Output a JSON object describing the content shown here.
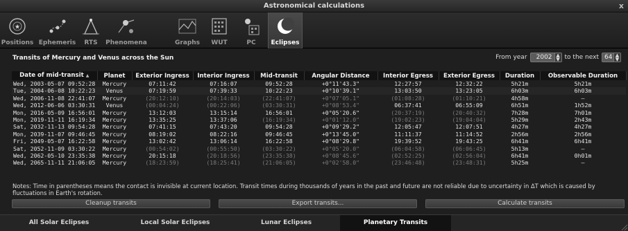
{
  "window": {
    "title": "Astronomical calculations",
    "close_label": "x"
  },
  "toolbar": {
    "tabs": [
      {
        "label": "Positions",
        "icon": "positions-icon"
      },
      {
        "label": "Ephemeris",
        "icon": "ephemeris-icon"
      },
      {
        "label": "RTS",
        "icon": "rts-icon"
      },
      {
        "label": "Phenomena",
        "icon": "phenomena-icon"
      },
      {
        "label": "Graphs",
        "icon": "graphs-icon"
      },
      {
        "label": "WUT",
        "icon": "wut-icon"
      },
      {
        "label": "PC",
        "icon": "pc-icon"
      },
      {
        "label": "Eclipses",
        "icon": "eclipses-icon",
        "active": true
      }
    ]
  },
  "transits": {
    "title": "Transits of Mercury and Venus across the Sun",
    "from_year_label": "From year",
    "from_year_value": "2002",
    "next_label": "to the next",
    "next_value": "64",
    "columns": [
      "Date of mid-transit",
      "Planet",
      "Exterior Ingress",
      "Interior Ingress",
      "Mid-transit",
      "Angular Distance",
      "Interior Egress",
      "Exterior Egress",
      "Duration",
      "Observable Duration"
    ],
    "rows": [
      {
        "date": "Wed, 2003-05-07 09:52:28",
        "planet": "Mercury",
        "ext_in": "07:11:42",
        "int_in": "07:16:07",
        "mid": "09:52:28",
        "ang": "+0°11'43.3\"",
        "int_eg": "12:27:57",
        "ext_eg": "12:32:22",
        "dur": "5h21m",
        "obs": "5h21m",
        "inv": []
      },
      {
        "date": "Tue, 2004-06-08 10:22:23",
        "planet": "Venus",
        "ext_in": "07:19:59",
        "int_in": "07:39:33",
        "mid": "10:22:23",
        "ang": "+0°10'39.1\"",
        "int_eg": "13:03:50",
        "ext_eg": "13:23:05",
        "dur": "6h03m",
        "obs": "6h03m",
        "inv": []
      },
      {
        "date": "Wed, 2006-11-08 22:41:07",
        "planet": "Mercury",
        "ext_in": "(20:12:10)",
        "int_in": "(20:14:03)",
        "mid": "(22:41:07)",
        "ang": "+0°07'05.1\"",
        "int_eg": "(01:08:28)",
        "ext_eg": "(01:10:21)",
        "dur": "4h58m",
        "obs": "—",
        "inv": [
          "ext_in",
          "int_in",
          "mid",
          "ang",
          "int_eg",
          "ext_eg"
        ]
      },
      {
        "date": "Wed, 2012-06-06 03:30:31",
        "planet": "Venus",
        "ext_in": "(00:04:24)",
        "int_in": "(00:22:06)",
        "mid": "(03:30:31)",
        "ang": "+0°08'53.4\"",
        "int_eg": "06:37:41",
        "ext_eg": "06:55:09",
        "dur": "6h51m",
        "obs": "1h52m",
        "inv": [
          "ext_in",
          "int_in",
          "mid",
          "ang"
        ]
      },
      {
        "date": "Mon, 2016-05-09 16:56:01",
        "planet": "Mercury",
        "ext_in": "13:12:03",
        "int_in": "13:15:14",
        "mid": "16:56:01",
        "ang": "+0°05'20.6\"",
        "int_eg": "(20:37:19)",
        "ext_eg": "(20:40:32)",
        "dur": "7h28m",
        "obs": "7h01m",
        "inv": [
          "int_eg",
          "ext_eg"
        ]
      },
      {
        "date": "Mon, 2019-11-11 16:19:34",
        "planet": "Mercury",
        "ext_in": "13:35:25",
        "int_in": "13:37:06",
        "mid": "(16:19:34)",
        "ang": "+0°01'12.0\"",
        "int_eg": "(19:02:23)",
        "ext_eg": "(19:04:04)",
        "dur": "5h29m",
        "obs": "2h43m",
        "inv": [
          "mid",
          "ang",
          "int_eg",
          "ext_eg"
        ]
      },
      {
        "date": "Sat, 2032-11-13 09:54:28",
        "planet": "Mercury",
        "ext_in": "07:41:15",
        "int_in": "07:43:20",
        "mid": "09:54:28",
        "ang": "+0°09'29.2\"",
        "int_eg": "12:05:47",
        "ext_eg": "12:07:51",
        "dur": "4h27m",
        "obs": "4h27m",
        "inv": []
      },
      {
        "date": "Mon, 2039-11-07 09:46:45",
        "planet": "Mercury",
        "ext_in": "08:19:02",
        "int_in": "08:22:16",
        "mid": "09:46:45",
        "ang": "+0°13'45.0\"",
        "int_eg": "11:11:37",
        "ext_eg": "11:14:52",
        "dur": "2h56m",
        "obs": "2h56m",
        "inv": []
      },
      {
        "date": "Fri, 2049-05-07 16:22:58",
        "planet": "Mercury",
        "ext_in": "13:02:42",
        "int_in": "13:06:14",
        "mid": "16:22:58",
        "ang": "+0°08'29.8\"",
        "int_eg": "19:39:52",
        "ext_eg": "19:43:25",
        "dur": "6h41m",
        "obs": "6h41m",
        "inv": []
      },
      {
        "date": "Sat, 2052-11-09 03:30:22",
        "planet": "Mercury",
        "ext_in": "(00:54:02)",
        "int_in": "(00:55:50)",
        "mid": "(03:30:22)",
        "ang": "+0°05'20.0\"",
        "int_eg": "(06:04:58)",
        "ext_eg": "(06:06:45)",
        "dur": "5h13m",
        "obs": "—",
        "inv": [
          "ext_in",
          "int_in",
          "mid",
          "ang",
          "int_eg",
          "ext_eg"
        ]
      },
      {
        "date": "Wed, 2062-05-10 23:35:38",
        "planet": "Mercury",
        "ext_in": "20:15:18",
        "int_in": "(20:18:56)",
        "mid": "(23:35:38)",
        "ang": "+0°08'45.6\"",
        "int_eg": "(02:52:25)",
        "ext_eg": "(02:56:04)",
        "dur": "6h41m",
        "obs": "0h01m",
        "inv": [
          "int_in",
          "mid",
          "ang",
          "int_eg",
          "ext_eg"
        ]
      },
      {
        "date": "Wed, 2065-11-11 21:06:05",
        "planet": "Mercury",
        "ext_in": "(18:23:59)",
        "int_in": "(18:25:41)",
        "mid": "(21:06:05)",
        "ang": "+0°02'58.0\"",
        "int_eg": "(23:46:48)",
        "ext_eg": "(23:48:31)",
        "dur": "5h25m",
        "obs": "—",
        "inv": [
          "ext_in",
          "int_in",
          "mid",
          "ang",
          "int_eg",
          "ext_eg"
        ]
      }
    ],
    "notes": "Notes: Time in parentheses means the contact is invisible at current location. Transit times during thousands of years in the past and future are not reliable due to uncertainty in ΔT which is caused by fluctuations in Earth's rotation.",
    "buttons": {
      "cleanup": "Cleanup transits",
      "export": "Export transits...",
      "calculate": "Calculate transits"
    }
  },
  "bottom_tabs": [
    {
      "label": "All Solar Eclipses",
      "active": false
    },
    {
      "label": "Local Solar Eclipses",
      "active": false
    },
    {
      "label": "Lunar Eclipses",
      "active": false
    },
    {
      "label": "Planetary Transits",
      "active": true
    }
  ],
  "colors": {
    "invisible_text": "#7c7c7c",
    "background": "#1f1f1f",
    "active_tab": "#121212"
  }
}
